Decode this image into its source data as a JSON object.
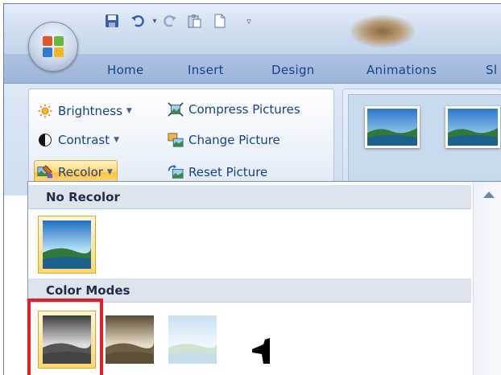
{
  "quick_access": {
    "items": [
      {
        "name": "save-icon",
        "glyph": "💾"
      },
      {
        "name": "undo-icon",
        "glyph": "↶"
      },
      {
        "name": "undo-dropdown-icon",
        "glyph": "▾"
      },
      {
        "name": "redo-icon",
        "glyph": "↷"
      },
      {
        "name": "paste-icon",
        "glyph": "📋"
      },
      {
        "name": "new-document-icon",
        "glyph": "🗋"
      },
      {
        "name": "customize-qat-icon",
        "glyph": "▿"
      }
    ]
  },
  "tabs": [
    {
      "label": "Home"
    },
    {
      "label": "Insert"
    },
    {
      "label": "Design"
    },
    {
      "label": "Animations"
    },
    {
      "label": "Sl"
    }
  ],
  "adjust": {
    "brightness": "Brightness",
    "contrast": "Contrast",
    "recolor": "Recolor",
    "compress": "Compress Pictures",
    "change": "Change Picture",
    "reset": "Reset Picture"
  },
  "recolor_menu": {
    "no_recolor_header": "No Recolor",
    "color_modes_header": "Color Modes",
    "color_modes": [
      {
        "name": "grayscale"
      },
      {
        "name": "sepia"
      },
      {
        "name": "washout"
      },
      {
        "name": "black-and-white"
      }
    ]
  },
  "colors": {
    "accent_orange": "#ffc13f",
    "highlight_red": "#e31e24",
    "tab_text": "#15428b"
  }
}
